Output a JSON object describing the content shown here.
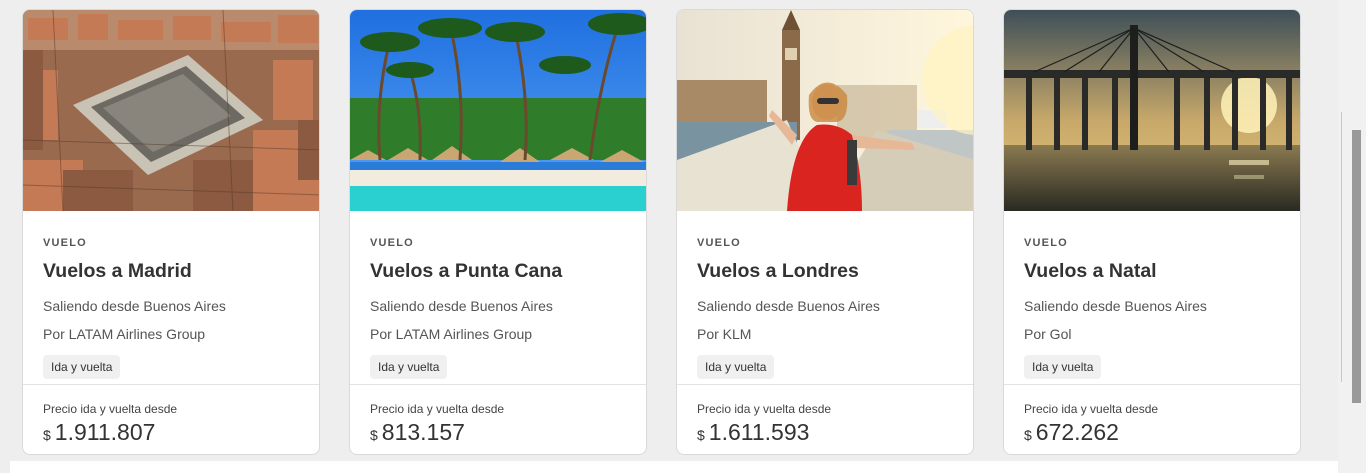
{
  "cards": [
    {
      "tag": "VUELO",
      "title": "Vuelos a Madrid",
      "origin": "Saliendo desde Buenos Aires",
      "airline": "Por LATAM Airlines Group",
      "trip_type": "Ida y vuelta",
      "price_label": "Precio ida y vuelta desde",
      "currency": "$",
      "price": "1.911.807"
    },
    {
      "tag": "VUELO",
      "title": "Vuelos a Punta Cana",
      "origin": "Saliendo desde Buenos Aires",
      "airline": "Por LATAM Airlines Group",
      "trip_type": "Ida y vuelta",
      "price_label": "Precio ida y vuelta desde",
      "currency": "$",
      "price": "813.157"
    },
    {
      "tag": "VUELO",
      "title": "Vuelos a Londres",
      "origin": "Saliendo desde Buenos Aires",
      "airline": "Por KLM",
      "trip_type": "Ida y vuelta",
      "price_label": "Precio ida y vuelta desde",
      "currency": "$",
      "price": "1.611.593"
    },
    {
      "tag": "VUELO",
      "title": "Vuelos a Natal",
      "origin": "Saliendo desde Buenos Aires",
      "airline": "Por Gol",
      "trip_type": "Ida y vuelta",
      "price_label": "Precio ida y vuelta desde",
      "currency": "$",
      "price": "672.262"
    }
  ]
}
